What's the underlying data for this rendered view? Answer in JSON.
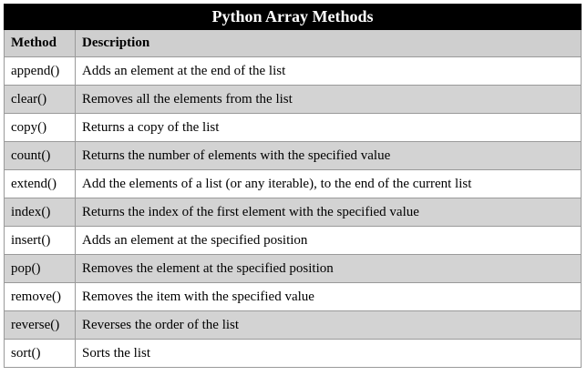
{
  "table": {
    "title": "Python Array Methods",
    "headers": [
      "Method",
      "Description"
    ],
    "rows": [
      {
        "method": "append()",
        "description": "Adds an element at the end of the list"
      },
      {
        "method": "clear()",
        "description": "Removes all the elements from the list"
      },
      {
        "method": "copy()",
        "description": "Returns a copy of the list"
      },
      {
        "method": "count()",
        "description": "Returns the number of elements with the specified value"
      },
      {
        "method": "extend()",
        "description": "Add the elements of a list (or any iterable), to the end of the current list"
      },
      {
        "method": "index()",
        "description": "Returns the index of the first element with the specified value"
      },
      {
        "method": "insert()",
        "description": "Adds an element at the specified position"
      },
      {
        "method": "pop()",
        "description": "Removes the element at the specified position"
      },
      {
        "method": "remove()",
        "description": "Removes the item with the specified value"
      },
      {
        "method": "reverse()",
        "description": "Reverses the order of the list"
      },
      {
        "method": "sort()",
        "description": "Sorts the list"
      }
    ]
  },
  "colors": {
    "title_background": "#000000",
    "title_text": "#ffffff",
    "header_background": "#cfcfcf",
    "shaded_row": "#d3d3d3",
    "plain_row": "#ffffff",
    "border": "#9a9a9a"
  }
}
